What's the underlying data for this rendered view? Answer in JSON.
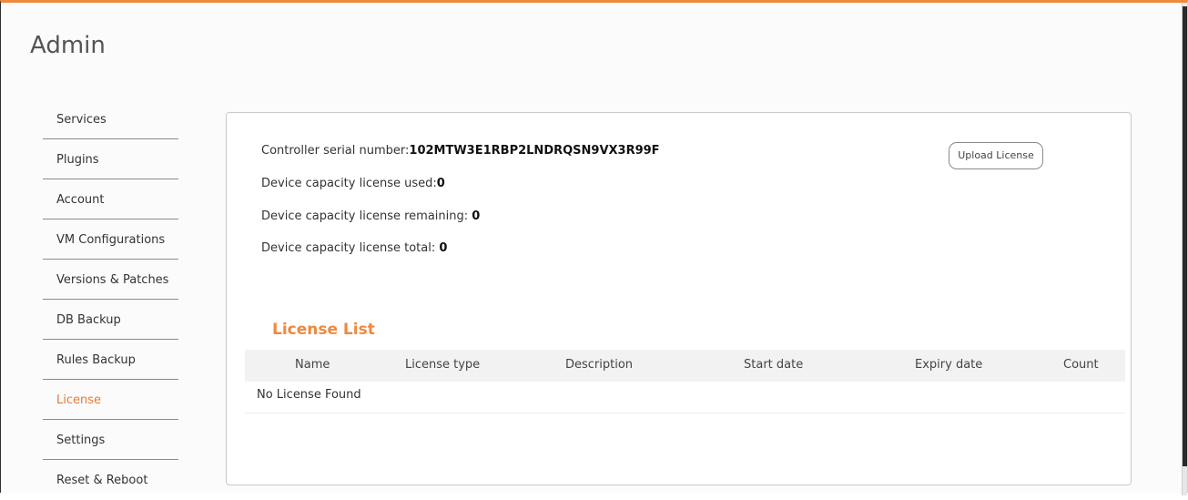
{
  "page": {
    "title": "Admin"
  },
  "sidebar": {
    "items": [
      {
        "label": "Services",
        "active": false
      },
      {
        "label": "Plugins",
        "active": false
      },
      {
        "label": "Account",
        "active": false
      },
      {
        "label": "VM Configurations",
        "active": false
      },
      {
        "label": "Versions & Patches",
        "active": false
      },
      {
        "label": "DB Backup",
        "active": false
      },
      {
        "label": "Rules Backup",
        "active": false
      },
      {
        "label": "License",
        "active": true
      },
      {
        "label": "Settings",
        "active": false
      },
      {
        "label": "Reset & Reboot",
        "active": false
      }
    ]
  },
  "license": {
    "serial_label": "Controller serial number:",
    "serial_value": "102MTW3E1RBP2LNDRQSN9VX3R99F",
    "used_label": "Device capacity license used:",
    "used_value": "0",
    "remaining_label": "Device capacity license remaining: ",
    "remaining_value": "0",
    "total_label": "Device capacity license total: ",
    "total_value": "0",
    "upload_button": "Upload License"
  },
  "license_list": {
    "title": "License List",
    "columns": [
      "Name",
      "License type",
      "Description",
      "Start date",
      "Expiry date",
      "Count"
    ],
    "empty_message": "No License Found"
  },
  "colors": {
    "accent": "#f0883d",
    "active_nav": "#e8793a"
  }
}
